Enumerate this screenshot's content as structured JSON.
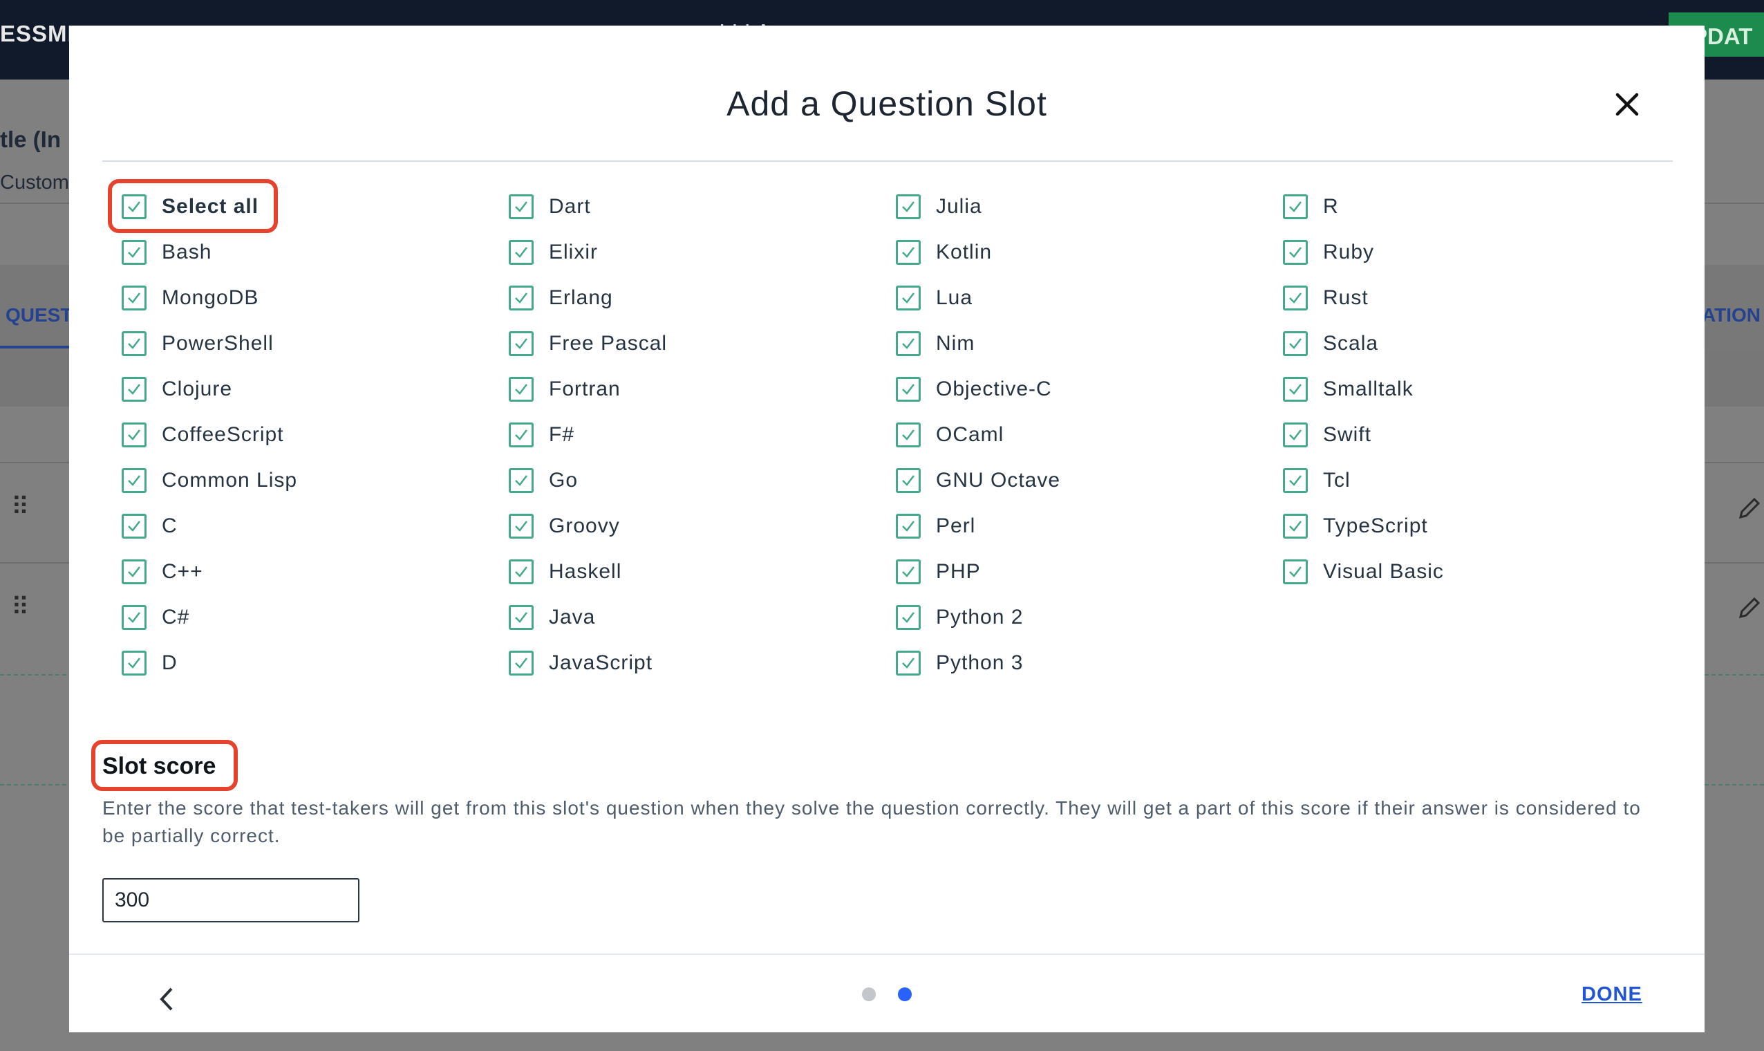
{
  "background": {
    "header_left": "ESSME",
    "header_title": "I I   I  A",
    "header_button": "PDAT",
    "page_title": "tle (In",
    "page_subtitle": "Custom",
    "tab_left": "QUEST",
    "tab_right": "ATION",
    "drag_handle": "⠿"
  },
  "modal": {
    "title": "Add a Question Slot",
    "close_label": "×",
    "select_all": {
      "label": "Select all",
      "checked": true
    },
    "languages": {
      "col1": [
        "Bash",
        "MongoDB",
        "PowerShell",
        "Clojure",
        "CoffeeScript",
        "Common Lisp",
        "C",
        "C++",
        "C#",
        "D"
      ],
      "col2": [
        "Dart",
        "Elixir",
        "Erlang",
        "Free Pascal",
        "Fortran",
        "F#",
        "Go",
        "Groovy",
        "Haskell",
        "Java",
        "JavaScript"
      ],
      "col3": [
        "Julia",
        "Kotlin",
        "Lua",
        "Nim",
        "Objective-C",
        "OCaml",
        "GNU Octave",
        "Perl",
        "PHP",
        "Python 2",
        "Python 3"
      ],
      "col4": [
        "R",
        "Ruby",
        "Rust",
        "Scala",
        "Smalltalk",
        "Swift",
        "Tcl",
        "TypeScript",
        "Visual Basic"
      ]
    },
    "slot_score": {
      "title": "Slot score",
      "description": "Enter the score that test-takers will get from this slot's question when they solve the question correctly. They will get a part of this score if their answer is considered to be partially correct.",
      "value": "300"
    },
    "footer": {
      "done_label": "DONE",
      "pagination": {
        "current": 2,
        "total": 2
      }
    }
  },
  "colors": {
    "checkbox": "#43a88c",
    "highlight": "#e5432d",
    "active_dot": "#2962ff",
    "done_link": "#2154d6"
  }
}
